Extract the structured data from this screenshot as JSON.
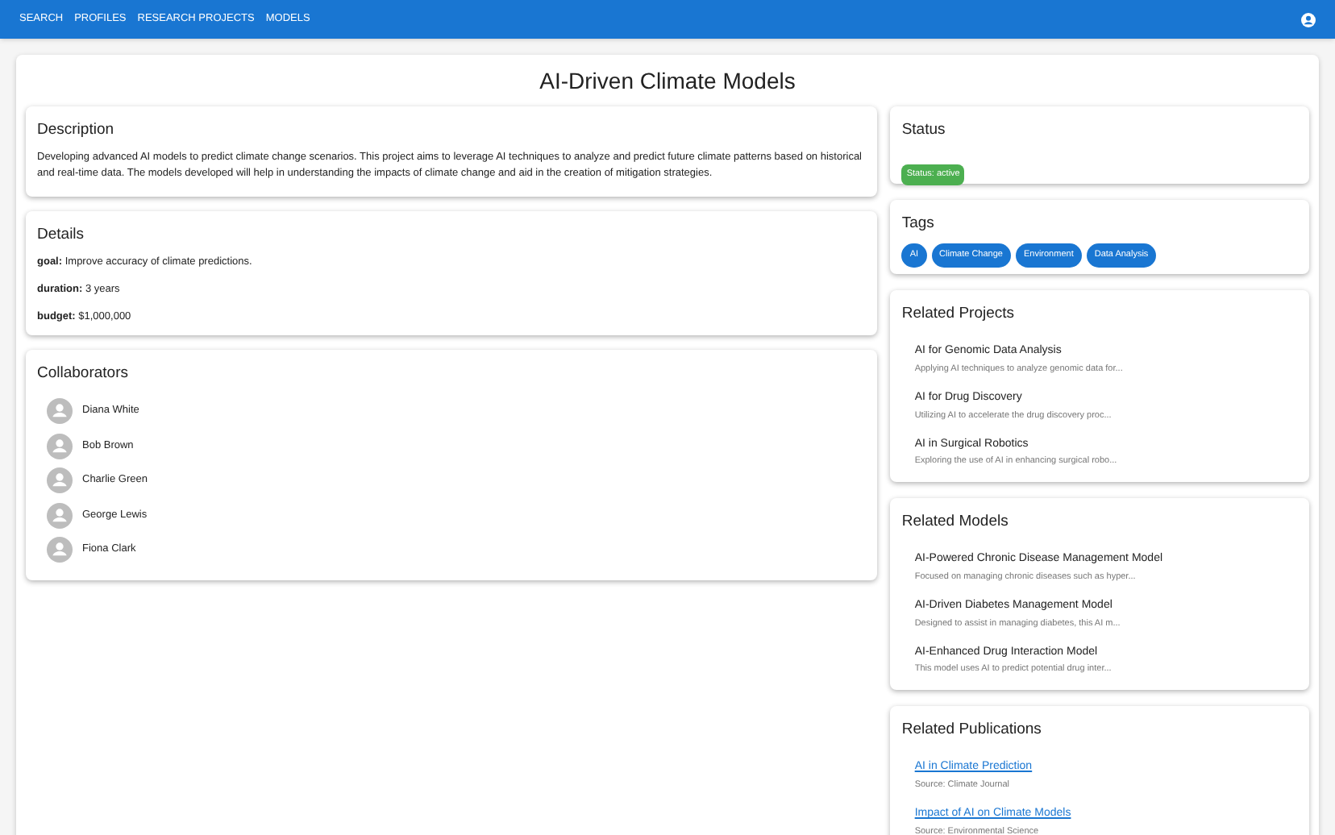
{
  "nav": {
    "links": [
      "SEARCH",
      "PROFILES",
      "RESEARCH PROJECTS",
      "MODELS"
    ]
  },
  "title": "AI-Driven Climate Models",
  "description": {
    "heading": "Description",
    "text": "Developing advanced AI models to predict climate change scenarios. This project aims to leverage AI techniques to analyze and predict future climate patterns based on historical and real-time data. The models developed will help in understanding the impacts of climate change and aid in the creation of mitigation strategies."
  },
  "details": {
    "heading": "Details",
    "items": [
      {
        "label": "goal:",
        "value": "Improve accuracy of climate predictions."
      },
      {
        "label": "duration:",
        "value": "3 years"
      },
      {
        "label": "budget:",
        "value": "$1,000,000"
      }
    ]
  },
  "collaborators": {
    "heading": "Collaborators",
    "people": [
      "Diana White",
      "Bob Brown",
      "Charlie Green",
      "George Lewis",
      "Fiona Clark"
    ]
  },
  "status": {
    "heading": "Status",
    "text": "Status: active",
    "color": "#4caf50"
  },
  "tags": {
    "heading": "Tags",
    "items": [
      "AI",
      "Climate Change",
      "Environment",
      "Data Analysis"
    ]
  },
  "related_projects": {
    "heading": "Related Projects",
    "items": [
      {
        "title": "AI for Genomic Data Analysis",
        "summary": "Applying AI techniques to analyze genomic data for..."
      },
      {
        "title": "AI for Drug Discovery",
        "summary": "Utilizing AI to accelerate the drug discovery proc..."
      },
      {
        "title": "AI in Surgical Robotics",
        "summary": "Exploring the use of AI in enhancing surgical robo..."
      }
    ]
  },
  "related_models": {
    "heading": "Related Models",
    "items": [
      {
        "title": "AI-Powered Chronic Disease Management Model",
        "summary": "Focused on managing chronic diseases such as hyper..."
      },
      {
        "title": "AI-Driven Diabetes Management Model",
        "summary": "Designed to assist in managing diabetes, this AI m..."
      },
      {
        "title": "AI-Enhanced Drug Interaction Model",
        "summary": "This model uses AI to predict potential drug inter..."
      }
    ]
  },
  "related_publications": {
    "heading": "Related Publications",
    "items": [
      {
        "title": "AI in Climate Prediction",
        "source": "Source: Climate Journal"
      },
      {
        "title": "Impact of AI on Climate Models",
        "source": "Source: Environmental Science"
      }
    ]
  }
}
